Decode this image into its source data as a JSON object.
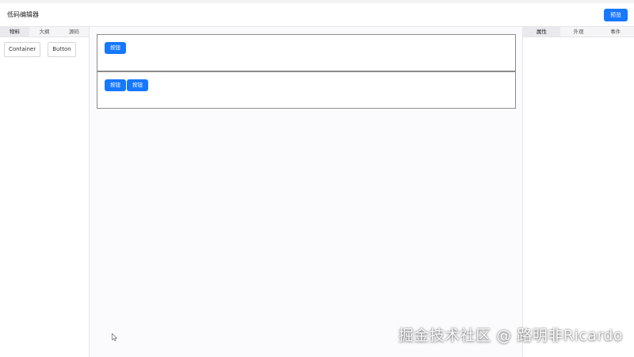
{
  "header": {
    "title": "低码编辑器",
    "preview_label": "预览"
  },
  "left_panel": {
    "tabs": [
      {
        "label": "物料"
      },
      {
        "label": "大纲"
      },
      {
        "label": "源码"
      }
    ],
    "materials": [
      {
        "label": "Container"
      },
      {
        "label": "Button"
      }
    ]
  },
  "canvas": {
    "containers": [
      {
        "buttons": [
          {
            "label": "按钮"
          }
        ]
      },
      {
        "buttons": [
          {
            "label": "按钮"
          },
          {
            "label": "按钮"
          }
        ]
      }
    ]
  },
  "right_panel": {
    "tabs": [
      {
        "label": "属性"
      },
      {
        "label": "外观"
      },
      {
        "label": "事件"
      }
    ]
  },
  "watermark": "掘金技术社区 @ 路明非Ricardo",
  "colors": {
    "accent": "#1677ff"
  },
  "icons": {
    "cursor": "mouse-pointer-icon"
  }
}
